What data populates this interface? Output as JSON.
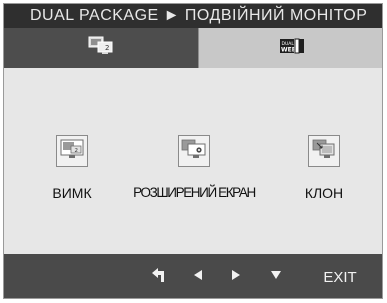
{
  "window": {
    "title": "DUAL PACKAGE ► ПОДВІЙНИЙ МОНІТОР"
  },
  "tabs": [
    {
      "name": "dual-package",
      "icon": "dual-monitor-icon",
      "active": true
    },
    {
      "name": "dual-web",
      "icon": "dual-web-icon",
      "active": false
    }
  ],
  "modes": [
    {
      "icon": "pip-icon",
      "label": "ВИМК"
    },
    {
      "icon": "extend-screen-icon",
      "label": "РОЗШИРЕНИЙ ЕКРАН"
    },
    {
      "icon": "clone-icon",
      "label": "КЛОН"
    }
  ],
  "footer": {
    "controls": [
      {
        "icon": "back-arrow-icon"
      },
      {
        "icon": "left-triangle-icon"
      },
      {
        "icon": "right-triangle-icon"
      },
      {
        "icon": "down-triangle-icon"
      }
    ],
    "exit_label": "EXIT"
  },
  "colors": {
    "title_bar": "#2f2f2f",
    "panel": "#e7e7e7",
    "active_tab": "#4d4d4d",
    "inactive_tab": "#c8c8c8",
    "footer": "#4a4a4a"
  }
}
